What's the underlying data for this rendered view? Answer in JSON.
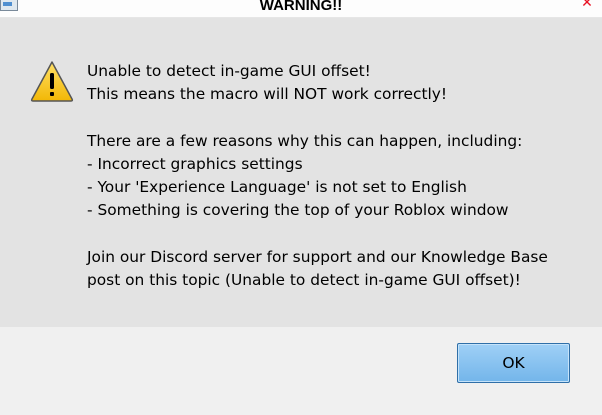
{
  "window": {
    "title": "WARNING!!",
    "close_glyph": "✕"
  },
  "dialog": {
    "icon": "warning-icon",
    "message_lines": [
      "Unable to detect in-game GUI offset!",
      "This means the macro will NOT work correctly!",
      "",
      "There are a few reasons why this can happen, including:",
      "- Incorrect graphics settings",
      "- Your 'Experience Language' is not set to English",
      "- Something is covering the top of your Roblox window",
      "",
      "Join our Discord server for support and our Knowledge Base",
      "post on this topic (Unable to detect in-game GUI offset)!"
    ]
  },
  "buttons": {
    "ok_label": "OK"
  },
  "colors": {
    "warning_yellow": "#f5c518",
    "ok_button": "#86c1ef",
    "close_red": "#e81123"
  }
}
